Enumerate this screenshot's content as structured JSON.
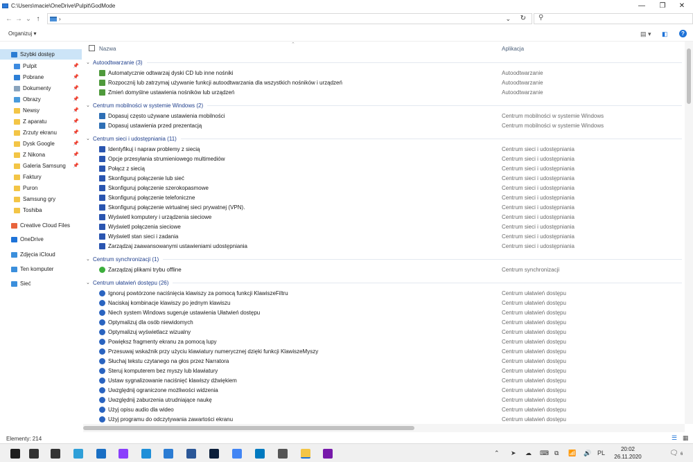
{
  "window": {
    "path": "C:\\Users\\macie\\OneDrive\\Pulpit\\GodMode",
    "minimize_glyph": "—",
    "maximize_glyph": "❐",
    "close_glyph": "✕"
  },
  "addressbar": {
    "back": "←",
    "forward": "→",
    "recent": "⌄",
    "up": "↑",
    "crumb_caret": "›",
    "dropdown": "⌄",
    "refresh": "↻",
    "search_glyph": "⚲"
  },
  "toolbar": {
    "organize_label": "Organizuj ▾",
    "help_label": "?"
  },
  "columns": {
    "name": "Nazwa",
    "app": "Aplikacja",
    "sort": "⌃"
  },
  "sidebar": {
    "items": [
      {
        "label": "Szybki dostęp",
        "icon": "star-icon",
        "color": "#2b7cd3",
        "pinned": false
      },
      {
        "label": "Pulpit",
        "icon": "desktop-icon",
        "color": "#3d8be0",
        "pinned": true
      },
      {
        "label": "Pobrane",
        "icon": "download-icon",
        "color": "#2d7fd6",
        "pinned": true
      },
      {
        "label": "Dokumenty",
        "icon": "documents-icon",
        "color": "#8aa4bd",
        "pinned": true
      },
      {
        "label": "Obrazy",
        "icon": "pictures-icon",
        "color": "#4a9bdc",
        "pinned": true
      },
      {
        "label": "Newsy",
        "icon": "folder-icon",
        "color": "#f3c546",
        "pinned": true
      },
      {
        "label": "Z aparatu",
        "icon": "folder-icon",
        "color": "#f3c546",
        "pinned": true
      },
      {
        "label": "Zrzuty ekranu",
        "icon": "folder-icon",
        "color": "#f3c546",
        "pinned": true
      },
      {
        "label": "Dysk Google",
        "icon": "folder-icon",
        "color": "#f3c546",
        "pinned": true
      },
      {
        "label": "Z Nikona",
        "icon": "folder-icon",
        "color": "#f3c546",
        "pinned": true
      },
      {
        "label": "Galeria Samsung",
        "icon": "folder-icon",
        "color": "#f3c546",
        "pinned": true
      },
      {
        "label": "Faktury",
        "icon": "folder-icon",
        "color": "#f3c546",
        "pinned": false
      },
      {
        "label": "Puron",
        "icon": "folder-icon",
        "color": "#f3c546",
        "pinned": false
      },
      {
        "label": "Samsung gry",
        "icon": "folder-icon",
        "color": "#f3c546",
        "pinned": false
      },
      {
        "label": "Toshiba",
        "icon": "folder-icon",
        "color": "#f3c546",
        "pinned": false
      },
      {
        "label": "Creative Cloud Files",
        "icon": "creative-cloud-icon",
        "color": "#e8643c",
        "pinned": false
      },
      {
        "label": "OneDrive",
        "icon": "cloud-icon",
        "color": "#1e73d8",
        "pinned": false
      },
      {
        "label": "Zdjęcia iCloud",
        "icon": "icloud-icon",
        "color": "#3b8fdc",
        "pinned": false
      },
      {
        "label": "Ten komputer",
        "icon": "computer-icon",
        "color": "#3b8fdc",
        "pinned": false
      },
      {
        "label": "Sieć",
        "icon": "network-icon",
        "color": "#3b8fdc",
        "pinned": false
      }
    ],
    "pin_glyph": "📌"
  },
  "groups": [
    {
      "title": "Autoodtwarzanie (3)",
      "icon": "autoplay-icon",
      "color": "#4f9a3c",
      "items": [
        {
          "name": "Automatycznie odtwarzaj dyski CD lub inne nośniki",
          "app": "Autoodtwarzanie"
        },
        {
          "name": "Rozpocznij lub zatrzymaj używanie funkcji autoodtwarzania dla wszystkich nośników i urządzeń",
          "app": "Autoodtwarzanie"
        },
        {
          "name": "Zmień domyślne ustawienia nośników lub urządzeń",
          "app": "Autoodtwarzanie"
        }
      ]
    },
    {
      "title": "Centrum mobilności w systemie Windows (2)",
      "icon": "mobility-icon",
      "color": "#2e6fb5",
      "items": [
        {
          "name": "Dopasuj często używane ustawienia mobilności",
          "app": "Centrum mobilności w systemie Windows"
        },
        {
          "name": "Dopasuj ustawienia przed prezentacją",
          "app": "Centrum mobilności w systemie Windows"
        }
      ]
    },
    {
      "title": "Centrum sieci i udostępniania (11)",
      "icon": "network-center-icon",
      "color": "#2a55b0",
      "items": [
        {
          "name": "Identyfikuj i napraw problemy z siecią",
          "app": "Centrum sieci i udostępniania"
        },
        {
          "name": "Opcje przesyłania strumieniowego multimediów",
          "app": "Centrum sieci i udostępniania"
        },
        {
          "name": "Połącz z siecią",
          "app": "Centrum sieci i udostępniania"
        },
        {
          "name": "Skonfiguruj połączenie lub sieć",
          "app": "Centrum sieci i udostępniania"
        },
        {
          "name": "Skonfiguruj połączenie szerokopasmowe",
          "app": "Centrum sieci i udostępniania"
        },
        {
          "name": "Skonfiguruj połączenie telefoniczne",
          "app": "Centrum sieci i udostępniania"
        },
        {
          "name": "Skonfiguruj połączenie wirtualnej sieci prywatnej (VPN).",
          "app": "Centrum sieci i udostępniania"
        },
        {
          "name": "Wyświetl komputery i urządzenia sieciowe",
          "app": "Centrum sieci i udostępniania"
        },
        {
          "name": "Wyświetl połączenia sieciowe",
          "app": "Centrum sieci i udostępniania"
        },
        {
          "name": "Wyświetl stan sieci i zadania",
          "app": "Centrum sieci i udostępniania"
        },
        {
          "name": "Zarządzaj zaawansowanymi ustawieniami udostępniania",
          "app": "Centrum sieci i udostępniania"
        }
      ]
    },
    {
      "title": "Centrum synchronizacji (1)",
      "icon": "sync-icon",
      "color": "#3cae3c",
      "items": [
        {
          "name": "Zarządzaj plikami trybu offline",
          "app": "Centrum synchronizacji"
        }
      ]
    },
    {
      "title": "Centrum ułatwień dostępu (26)",
      "icon": "accessibility-icon",
      "color": "#2a64c0",
      "items": [
        {
          "name": "Ignoruj powtórzone naciśnięcia klawiszy za pomocą funkcji KlawiszeFiltru",
          "app": "Centrum ułatwień dostępu"
        },
        {
          "name": "Naciskaj kombinacje klawiszy po jednym klawiszu",
          "app": "Centrum ułatwień dostępu"
        },
        {
          "name": "Niech system Windows sugeruje ustawienia Ułatwień dostępu",
          "app": "Centrum ułatwień dostępu"
        },
        {
          "name": "Optymalizuj dla osób niewidomych",
          "app": "Centrum ułatwień dostępu"
        },
        {
          "name": "Optymalizuj wyświetlacz wizualny",
          "app": "Centrum ułatwień dostępu"
        },
        {
          "name": "Powiększ fragmenty ekranu za pomocą lupy",
          "app": "Centrum ułatwień dostępu"
        },
        {
          "name": "Przesuwaj wskaźnik przy użyciu klawiatury numerycznej dzięki funkcji KlawiszeMyszy",
          "app": "Centrum ułatwień dostępu"
        },
        {
          "name": "Słuchaj tekstu czytanego na głos przez Narratora",
          "app": "Centrum ułatwień dostępu"
        },
        {
          "name": "Steruj komputerem bez myszy lub klawiatury",
          "app": "Centrum ułatwień dostępu"
        },
        {
          "name": "Ustaw sygnalizowanie naciśnięć klawiszy dźwiękiem",
          "app": "Centrum ułatwień dostępu"
        },
        {
          "name": "Uwzględnij ograniczone możliwości widzenia",
          "app": "Centrum ułatwień dostępu"
        },
        {
          "name": "Uwzględnij zaburzenia utrudniające naukę",
          "app": "Centrum ułatwień dostępu"
        },
        {
          "name": "Użyj opisu audio dla wideo",
          "app": "Centrum ułatwień dostępu"
        },
        {
          "name": "Użyj programu do odczytywania zawartości ekranu",
          "app": "Centrum ułatwień dostępu"
        }
      ]
    }
  ],
  "status": {
    "count": "Elementy: 214"
  },
  "taskbar": {
    "apps": [
      {
        "icon": "windows-start-icon",
        "color": "#1f1f1f"
      },
      {
        "icon": "search-icon",
        "color": "#333333"
      },
      {
        "icon": "task-view-icon",
        "color": "#333333"
      },
      {
        "icon": "edge-icon",
        "color": "#2f9fd8"
      },
      {
        "icon": "mail-icon",
        "color": "#1a6fc4"
      },
      {
        "icon": "messenger-icon",
        "color": "#8a3ffc"
      },
      {
        "icon": "maps-icon",
        "color": "#1f8fd8"
      },
      {
        "icon": "phone-icon",
        "color": "#2b7cd3"
      },
      {
        "icon": "word-icon",
        "color": "#2b5797"
      },
      {
        "icon": "photoshop-icon",
        "color": "#0b1e3a"
      },
      {
        "icon": "google-drive-icon",
        "color": "#4285f4"
      },
      {
        "icon": "trello-icon",
        "color": "#0079bf"
      },
      {
        "icon": "calculator-icon",
        "color": "#555555"
      },
      {
        "icon": "file-explorer-icon",
        "color": "#f3c546"
      },
      {
        "icon": "onenote-icon",
        "color": "#7719aa"
      }
    ],
    "tray_glyphs": [
      "⌃",
      "➤",
      "☁",
      "⌨",
      "⧉",
      "📶",
      "🔊",
      "PL"
    ],
    "time": "20:02",
    "date": "26.11.2020",
    "notify_glyph": "🗨",
    "notify_count": "6"
  }
}
